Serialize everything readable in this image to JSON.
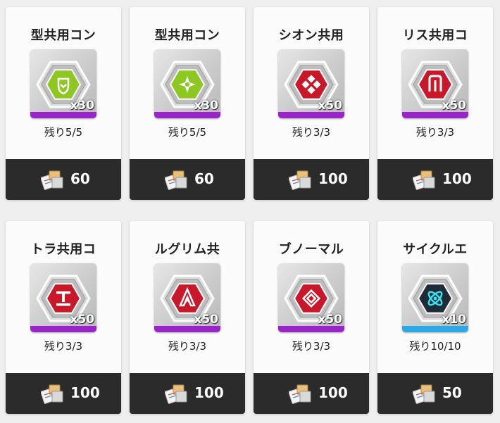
{
  "cards": [
    {
      "title": "型共用コン",
      "qty": "x30",
      "remain": "残り5/5",
      "price": "60",
      "gem_color": "#8cc821",
      "bar_color": "#9a23c9",
      "icon": "shield-badge-icon"
    },
    {
      "title": "型共用コン",
      "qty": "x30",
      "remain": "残り5/5",
      "price": "60",
      "gem_color": "#8cc821",
      "bar_color": "#9a23c9",
      "icon": "star-burst-icon"
    },
    {
      "title": "シオン共用",
      "qty": "x50",
      "remain": "残り3/3",
      "price": "100",
      "gem_color": "#c8182a",
      "bar_color": "#9a23c9",
      "icon": "diamond-grid-icon"
    },
    {
      "title": "リス共用コ",
      "qty": "x50",
      "remain": "残り3/3",
      "price": "100",
      "gem_color": "#c8182a",
      "bar_color": "#9a23c9",
      "icon": "gate-icon"
    },
    {
      "title": "トラ共用コ",
      "qty": "x50",
      "remain": "残り3/3",
      "price": "100",
      "gem_color": "#c8182a",
      "bar_color": "#9a23c9",
      "icon": "tee-icon"
    },
    {
      "title": "ルグリム共",
      "qty": "x50",
      "remain": "残り3/3",
      "price": "100",
      "gem_color": "#c8182a",
      "bar_color": "#9a23c9",
      "icon": "arrow-emblem-icon"
    },
    {
      "title": "ブノーマル",
      "qty": "x50",
      "remain": "残り3/3",
      "price": "100",
      "gem_color": "#c8182a",
      "bar_color": "#9a23c9",
      "icon": "maze-diamond-icon"
    },
    {
      "title": "サイクルエ",
      "qty": "x10",
      "remain": "残り10/10",
      "price": "50",
      "gem_color": "#1f2b36",
      "bar_color": "#2aa8e8",
      "icon": "orbit-icon"
    }
  ]
}
